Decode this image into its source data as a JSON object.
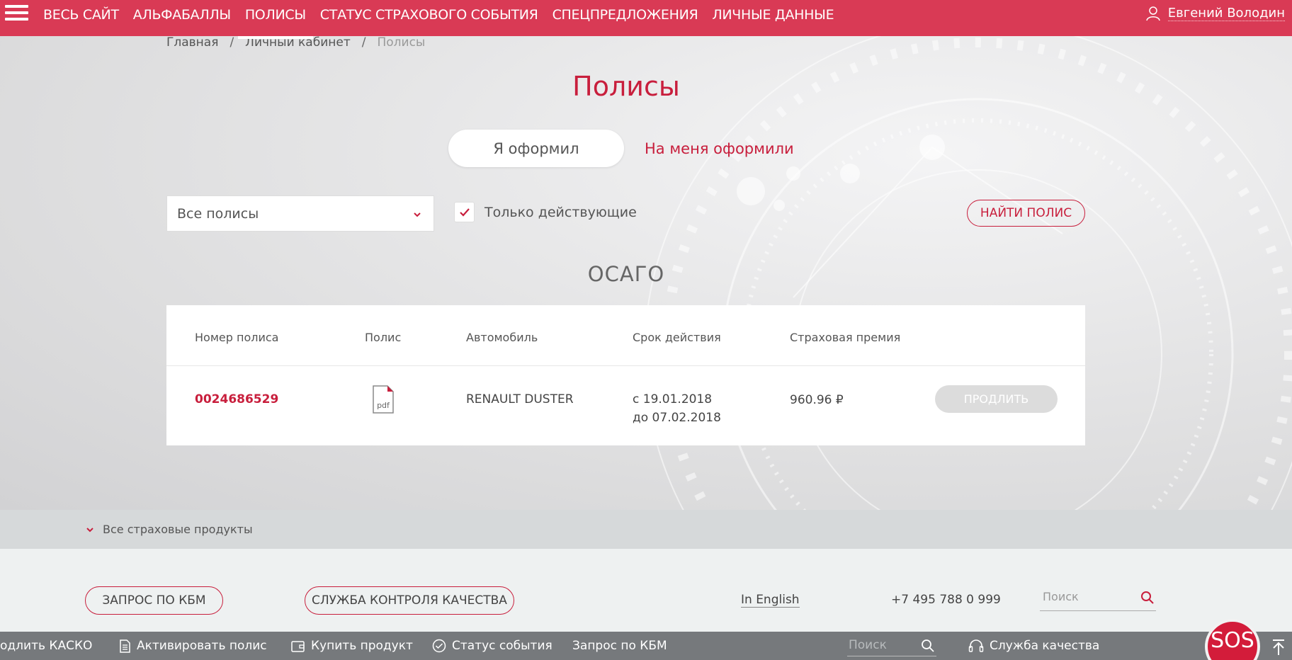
{
  "nav": {
    "items": [
      {
        "label": "ВЕСЬ САЙТ",
        "active": false
      },
      {
        "label": "АЛЬФАБАЛЛЫ",
        "active": false
      },
      {
        "label": "ПОЛИСЫ",
        "active": true
      },
      {
        "label": "СТАТУС СТРАХОВОГО СОБЫТИЯ",
        "active": false
      },
      {
        "label": "СПЕЦПРЕДЛОЖЕНИЯ",
        "active": false
      },
      {
        "label": "ЛИЧНЫЕ ДАННЫЕ",
        "active": false
      }
    ],
    "user_name": "Евгений Володин",
    "accent_color": "#d93a55"
  },
  "breadcrumb": {
    "home": "Главная",
    "cabinet": "Личный кабинет",
    "current": "Полисы"
  },
  "page": {
    "title": "Полисы",
    "tab_active": "Я оформил",
    "tab_other": "На меня оформили"
  },
  "filters": {
    "select_value": "Все полисы",
    "only_active_label": "Только действующие",
    "only_active_checked": true,
    "find_button": "НАЙТИ ПОЛИС"
  },
  "section": {
    "title": "ОСАГО"
  },
  "table": {
    "headers": [
      "Номер полиса",
      "Полис",
      "Автомобиль",
      "Срок действия",
      "Страховая премия"
    ],
    "rows": [
      {
        "number": "0024686529",
        "doc_icon": "pdf-icon",
        "doc_label": "pdf",
        "car": "RENAULT DUSTER",
        "from": "с 19.01.2018",
        "to": "до 07.02.2018",
        "premium": "960.96 ₽",
        "action": "ПРОДЛИТЬ"
      }
    ]
  },
  "products_bar": {
    "label": "Все страховые продукты"
  },
  "footer": {
    "kbm_button": "ЗАПРОС ПО КБМ",
    "quality_button": "СЛУЖБА КОНТРОЛЯ КАЧЕСТВА",
    "english": "In English",
    "phone": "+7 495 788 0 999",
    "search_placeholder": "Поиск"
  },
  "bottombar": {
    "extend_kasko": "одлить КАСКО",
    "activate": "Активировать полис",
    "buy": "Купить продукт",
    "status": "Статус события",
    "kbm": "Запрос по КБМ",
    "search_placeholder": "Поиск",
    "quality": "Служба качества",
    "sos": "SOS"
  }
}
